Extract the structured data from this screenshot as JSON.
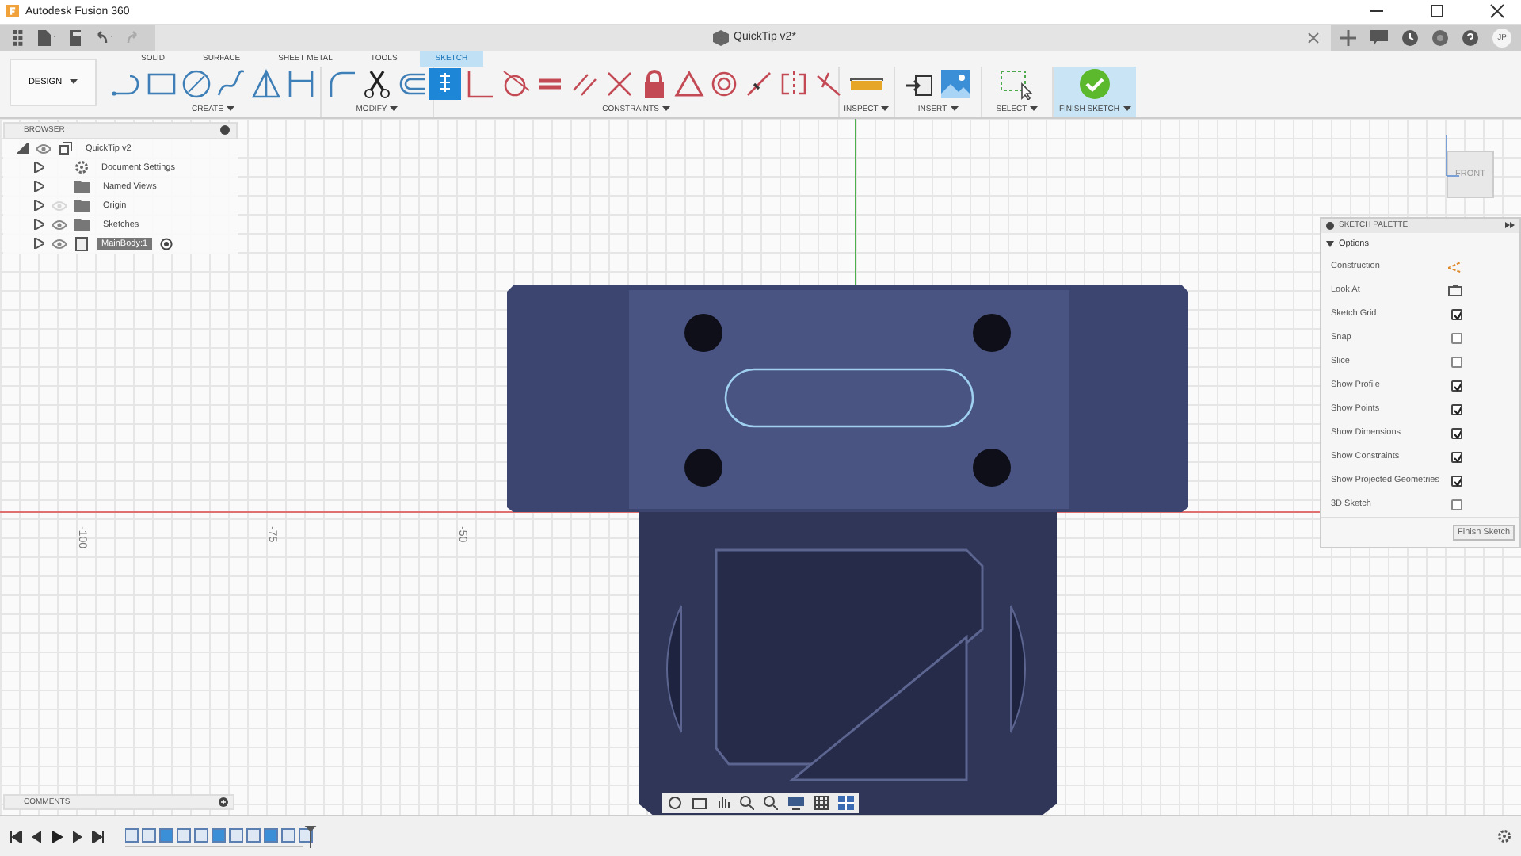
{
  "window": {
    "title": "Autodesk Fusion 360"
  },
  "document_tab": {
    "title": "QuickTip v2*"
  },
  "user": {
    "initials": "JP"
  },
  "workspace": {
    "label": "DESIGN"
  },
  "ribbon_tabs": [
    {
      "label": "SOLID",
      "selected": false
    },
    {
      "label": "SURFACE",
      "selected": false
    },
    {
      "label": "SHEET METAL",
      "selected": false
    },
    {
      "label": "TOOLS",
      "selected": false
    },
    {
      "label": "SKETCH",
      "selected": true
    }
  ],
  "tool_groups": [
    {
      "label": "CREATE"
    },
    {
      "label": "MODIFY"
    },
    {
      "label": "CONSTRAINTS"
    },
    {
      "label": "INSPECT"
    },
    {
      "label": "INSERT"
    },
    {
      "label": "SELECT"
    },
    {
      "label": "FINISH SKETCH"
    }
  ],
  "browser": {
    "title": "BROWSER",
    "items": [
      {
        "label": "QuickTip v2",
        "kind": "document",
        "expanded": true,
        "visible": true,
        "selected": false,
        "children": [
          {
            "label": "Document Settings",
            "kind": "settings",
            "expanded": false,
            "selected": false
          },
          {
            "label": "Named Views",
            "kind": "folder",
            "expanded": false,
            "selected": false
          },
          {
            "label": "Origin",
            "kind": "folder",
            "expanded": false,
            "visible": false,
            "selected": false
          },
          {
            "label": "Sketches",
            "kind": "folder",
            "expanded": false,
            "visible": true,
            "selected": false
          },
          {
            "label": "MainBody:1",
            "kind": "body",
            "expanded": false,
            "visible": true,
            "selected": true
          }
        ]
      }
    ]
  },
  "viewcube": {
    "label": "FRONT"
  },
  "ruler_labels": [
    "-100",
    "-75",
    "-50"
  ],
  "sketch_palette": {
    "title": "SKETCH PALETTE",
    "section": "Options",
    "options": [
      {
        "label": "Construction",
        "kind": "construction"
      },
      {
        "label": "Look At",
        "kind": "lookat"
      },
      {
        "label": "Sketch Grid",
        "kind": "checkbox",
        "checked": true
      },
      {
        "label": "Snap",
        "kind": "checkbox",
        "checked": false
      },
      {
        "label": "Slice",
        "kind": "checkbox",
        "checked": false
      },
      {
        "label": "Show Profile",
        "kind": "checkbox",
        "checked": true
      },
      {
        "label": "Show Points",
        "kind": "checkbox",
        "checked": true
      },
      {
        "label": "Show Dimensions",
        "kind": "checkbox",
        "checked": true
      },
      {
        "label": "Show Constraints",
        "kind": "checkbox",
        "checked": true
      },
      {
        "label": "Show Projected Geometries",
        "kind": "checkbox",
        "checked": true
      },
      {
        "label": "3D Sketch",
        "kind": "checkbox",
        "checked": false
      }
    ],
    "button": "Finish Sketch"
  },
  "comments": {
    "title": "COMMENTS"
  }
}
